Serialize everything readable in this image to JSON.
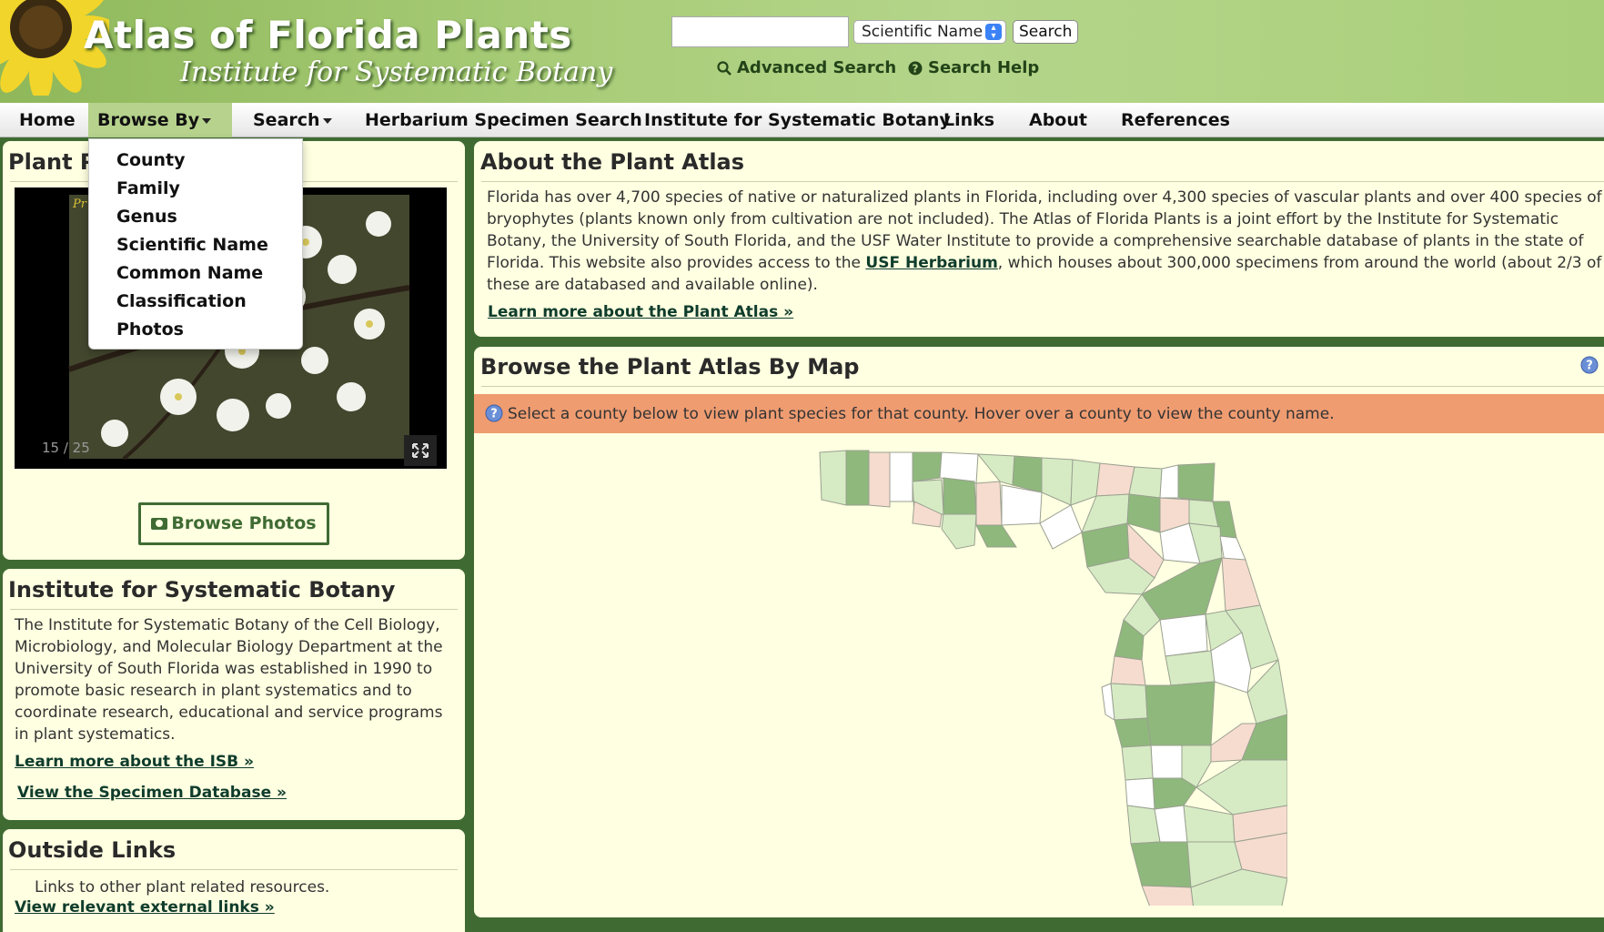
{
  "header": {
    "title": "Atlas of Florida Plants",
    "subtitle": "Institute for Systematic Botany",
    "search_placeholder": "",
    "search_type_selected": "Scientific Name",
    "search_button": "Search",
    "advanced_search": "Advanced Search",
    "search_help": "Search Help"
  },
  "nav": {
    "items": [
      "Home",
      "Browse By",
      "Search",
      "Herbarium Specimen Search",
      "Institute for Systematic Botany",
      "Links",
      "About",
      "References"
    ]
  },
  "browse_dropdown": {
    "items": [
      "County",
      "Family",
      "Genus",
      "Scientific Name",
      "Common Name",
      "Classification",
      "Photos"
    ]
  },
  "photos_panel": {
    "title": "Plant P",
    "photo_counter": "15 / 25",
    "browse_button": "Browse Photos"
  },
  "isb_panel": {
    "title": "Institute for Systematic Botany",
    "text": "The Institute for Systematic Botany of the Cell Biology, Microbiology, and Molecular Biology Department at the University of South Florida was established in 1990 to promote basic research in plant systematics and to coordinate research, educational and service programs in plant systematics.",
    "link1": "Learn more about the ISB »",
    "link2": "View the Specimen Database »"
  },
  "outside_panel": {
    "title": "Outside Links",
    "text": "Links to other plant related resources.",
    "link": "View relevant external links »"
  },
  "about_panel": {
    "title": "About the Plant Atlas",
    "text_before": "Florida has over 4,700 species of native or naturalized plants in Florida, including over 4,300 species of vascular plants and over 400 species of bryophytes (plants known only from cultivation are not included). The Atlas of Florida Plants is a joint effort by the Institute for Systematic Botany, the University of South Florida, and the USF Water Institute to provide a comprehensive searchable database of plants in the state of Florida. This website also provides access to the ",
    "herbarium_link": "USF Herbarium",
    "text_after": ", which houses about 300,000 specimens from around the world (about 2/3 of these are databased and available online).",
    "link": "Learn more about the Plant Atlas »"
  },
  "map_panel": {
    "title": "Browse the Plant Atlas By Map",
    "info": "Select a county below to view plant species for that county. Hover over a county to view the county name."
  },
  "colors": {
    "header_green": "#a8cc78",
    "panel_bg": "#ffffe1",
    "frame_green": "#3f6b33",
    "info_bar": "#ef9c71",
    "county_dark": "#8fb87c",
    "county_light": "#d6ebc4",
    "county_pink": "#f6dccf",
    "county_white": "#ffffff"
  }
}
